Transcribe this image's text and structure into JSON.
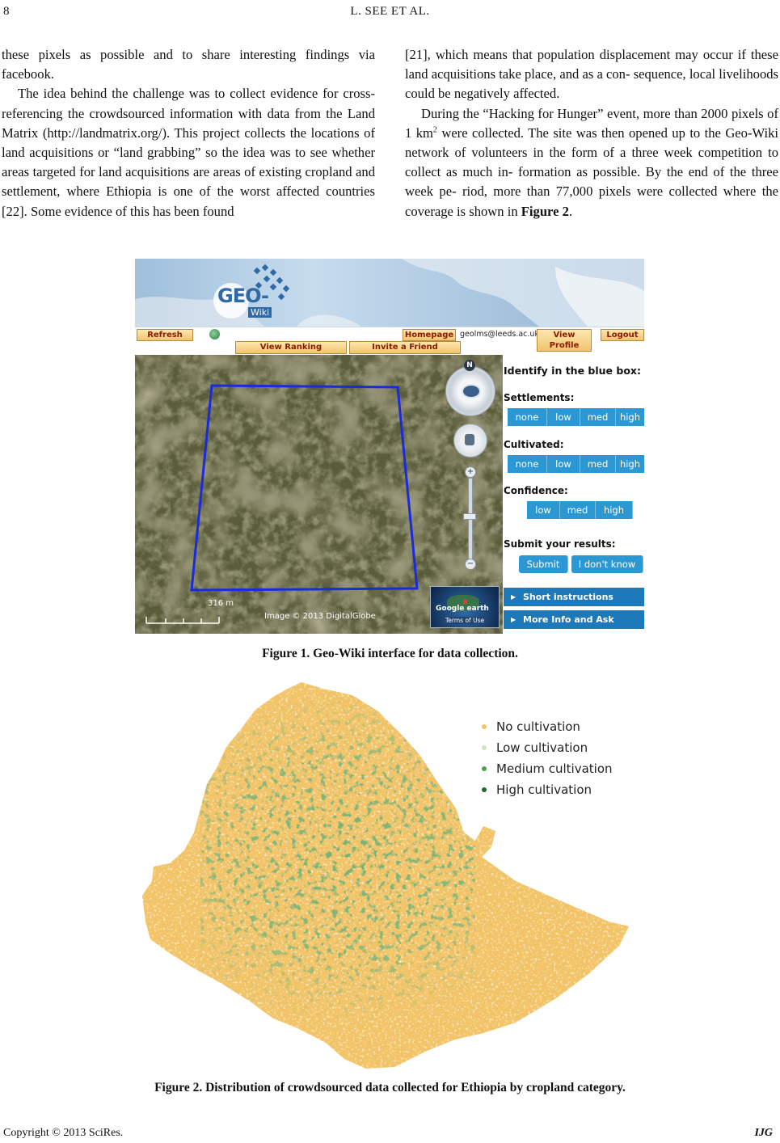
{
  "header": {
    "page_number": "8",
    "running_head": "L. SEE    ET    AL."
  },
  "left_column": {
    "para1": "these pixels as possible and to share interesting findings via facebook.",
    "para2": "The idea behind the challenge was to collect evidence for cross-referencing the crowdsourced information with data from the Land Matrix (http://landmatrix.org/). This project collects the locations of land acquisitions or “land grabbing” so the idea was to see whether areas targeted for land acquisitions are areas of existing cropland and settlement, where Ethiopia is one of the worst affected countries [22]. Some evidence of this has been found"
  },
  "right_column": {
    "para1": "[21], which means that population displacement may occur if these land acquisitions take place, and as a con- sequence, local livelihoods could be negatively affected.",
    "para2_a": "During the “Hacking for Hunger” event, more than 2000 pixels of 1 km",
    "para2_sup": "2",
    "para2_b": " were collected. The site was then opened up to the Geo-Wiki network of volunteers in the form of a three week competition to collect as much in- formation as possible. By the end of the three week pe- riod, more than 77,000 pixels were collected where the coverage is shown in ",
    "para2_ref": "Figure 2",
    "para2_end": "."
  },
  "figure1": {
    "caption": "Figure 1. Geo-Wiki interface for data collection.",
    "ui": {
      "logo_main": "GEO-",
      "logo_sub": "Wiki",
      "refresh": "Refresh",
      "homepage": "Homepage",
      "email": "geolms@leeds.ac.uk",
      "view_profile": "View Profile",
      "logout": "Logout",
      "view_ranking": "View Ranking",
      "invite_friend": "Invite a Friend",
      "compass_n": "N",
      "identify": "Identify in the blue box:",
      "settlements": "Settlements:",
      "cultivated": "Cultivated:",
      "confidence": "Confidence:",
      "submit_results": "Submit your results:",
      "levels4": [
        "none",
        "low",
        "med",
        "high"
      ],
      "levels3": [
        "low",
        "med",
        "high"
      ],
      "submit": "Submit",
      "dont_know": "I don't know",
      "short_instructions": "Short instructions",
      "more_info": "More Info and Ask Experts",
      "scale": "316 m",
      "image_credit": "Image © 2013 DigitalGlobe",
      "google_earth": "Google earth",
      "terms": "Terms of Use"
    }
  },
  "figure2": {
    "caption": "Figure 2. Distribution of crowdsourced data collected for Ethiopia by cropland category.",
    "legend": [
      {
        "label": "No cultivation",
        "color": "#f2c467"
      },
      {
        "label": "Low cultivation",
        "color": "#cfe8c0"
      },
      {
        "label": "Medium cultivation",
        "color": "#48a54a"
      },
      {
        "label": "High cultivation",
        "color": "#1e6b2a"
      }
    ]
  },
  "footer": {
    "copyright": "Copyright © 2013 SciRes.",
    "journal": "IJG"
  }
}
